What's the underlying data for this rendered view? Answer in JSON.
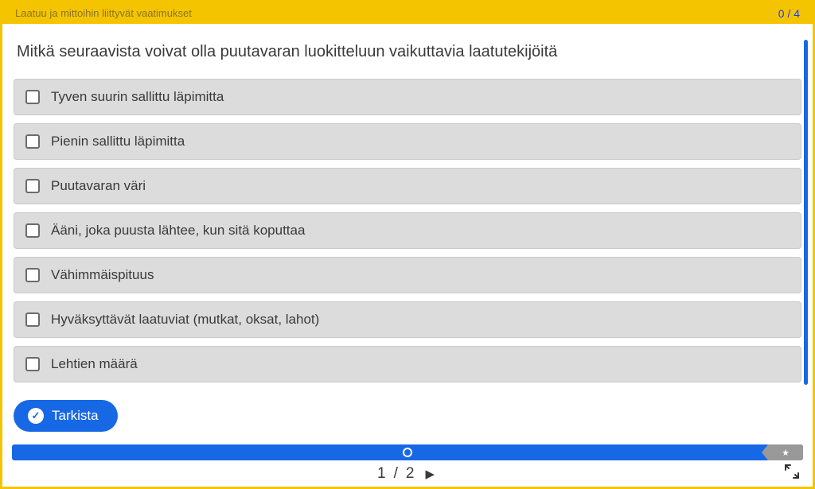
{
  "header": {
    "title": "Laatuu ja mittoihin liittyvät vaatimukset",
    "score": "0 / 4"
  },
  "question": "Mitkä seuraavista voivat olla puutavaran luokitteluun vaikuttavia laatutekijöitä",
  "options": [
    "Tyven suurin sallittu läpimitta",
    "Pienin sallittu läpimitta",
    "Puutavaran väri",
    "Ääni, joka puusta lähtee, kun sitä koputtaa",
    "Vähimmäispituus",
    "Hyväksyttävät laatuviat (mutkat, oksat, lahot)",
    "Lehtien määrä"
  ],
  "buttons": {
    "check_label": "Tarkista"
  },
  "pager": {
    "current": "1",
    "separator": "/",
    "total": "2"
  }
}
